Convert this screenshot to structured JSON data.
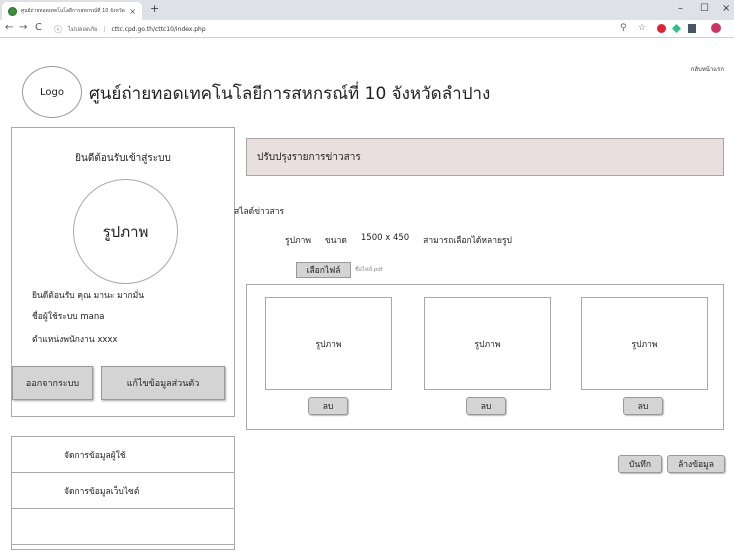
{
  "browser": {
    "tab_title": "ศูนย์ถ่ายทอดเทคโนโลยีการสหกรณ์ที่ 10 จังหวัดลำปาง",
    "tab_close": "×",
    "new_tab": "+",
    "url_security_label": "ไม่ปลอดภัย",
    "url_separator": "|",
    "url": "cttc.cpd.go.th/cttc10/index.php",
    "window_controls": {
      "minimize": "–",
      "maximize": "☐",
      "close": "×"
    },
    "nav": {
      "back": "←",
      "forward": "→",
      "reload": "C"
    },
    "tools": {
      "zoom": "⚲",
      "star": "☆"
    }
  },
  "header": {
    "logo_text": "Logo",
    "site_title": "ศูนย์ถ่ายทอดเทคโนโลยีการสหกรณ์ที่ 10 จังหวัดลำปาง",
    "back_link": "กลับหน้าแรก"
  },
  "user_panel": {
    "heading": "ยินดีต้อนรับเข้าสู่ระบบ",
    "avatar_text": "รูปภาพ",
    "welcome_line": "ยินดีต้อนรับ คุณ มานะ มากมั่น",
    "username_line": "ชื่อผู้ใช้ระบบ mana",
    "position_line": "ตำแหน่งพนักงาน xxxx",
    "logout_button": "ออกจากระบบ",
    "edit_profile_button": "แก้ไขข้อมูลส่วนตัว"
  },
  "side_menu": {
    "items": [
      {
        "label": "จัดการข้อมูลผู้ใช้"
      },
      {
        "label": "จัดการข้อมูลเว็บไซต์"
      },
      {
        "label": ""
      }
    ]
  },
  "content": {
    "header_title": "ปรับปรุงรายการข่าวสาร",
    "section_label": "สไลด์ข่าวสาร",
    "image_spec": {
      "image_label": "รูปภาพ",
      "size_label": "ขนาด",
      "dimensions": "1500 x 450",
      "multi_select_note": "สามารถเลือกได้หลายรูป"
    },
    "choose_file_button": "เลือกไฟล์",
    "file_name": "ชื่อไฟล์.pdf",
    "images": [
      {
        "label": "รูปภาพ",
        "delete_label": "ลบ"
      },
      {
        "label": "รูปภาพ",
        "delete_label": "ลบ"
      },
      {
        "label": "รูปภาพ",
        "delete_label": "ลบ"
      }
    ],
    "save_button": "บันทึก",
    "clear_button": "ล้างข้อมูล"
  },
  "colors": {
    "content_header_bg": "#eadfdf",
    "button_bg": "#d4d4d4",
    "border": "#aaaaaa"
  }
}
